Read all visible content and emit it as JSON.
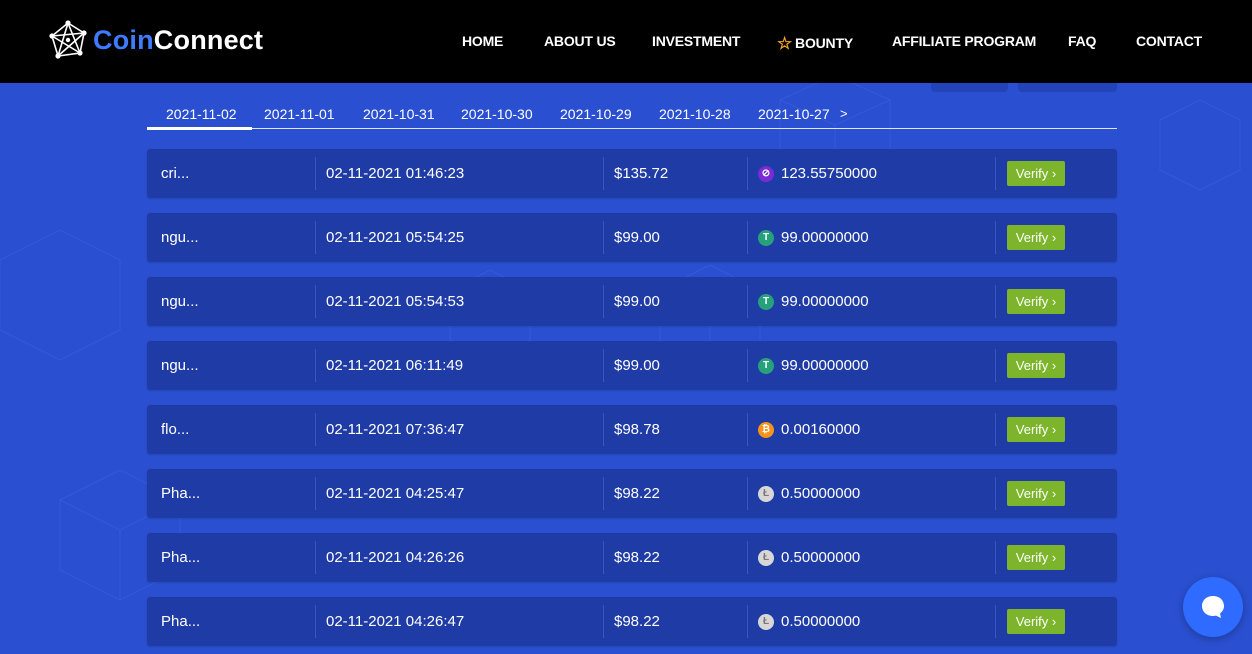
{
  "brand": {
    "part1": "Coin",
    "part2": "Connect"
  },
  "nav": {
    "home": "HOME",
    "about": "ABOUT US",
    "investment": "INVESTMENT",
    "bounty": "BOUNTY",
    "affiliate": "AFFILIATE PROGRAM",
    "faq": "FAQ",
    "contact": "CONTACT"
  },
  "tabs": [
    "2021-11-02",
    "2021-11-01",
    "2021-10-31",
    "2021-10-30",
    "2021-10-29",
    "2021-10-28",
    "2021-10-27"
  ],
  "tab_next": ">",
  "verify_label": "Verify ›",
  "rows": [
    {
      "user": "cri...",
      "time": "02-11-2021 01:46:23",
      "amount": "$135.72",
      "coin": "stellar",
      "coin_amount": "123.55750000"
    },
    {
      "user": "ngu...",
      "time": "02-11-2021 05:54:25",
      "amount": "$99.00",
      "coin": "tether",
      "coin_amount": "99.00000000"
    },
    {
      "user": "ngu...",
      "time": "02-11-2021 05:54:53",
      "amount": "$99.00",
      "coin": "tether",
      "coin_amount": "99.00000000"
    },
    {
      "user": "ngu...",
      "time": "02-11-2021 06:11:49",
      "amount": "$99.00",
      "coin": "tether",
      "coin_amount": "99.00000000"
    },
    {
      "user": "flo...",
      "time": "02-11-2021 07:36:47",
      "amount": "$98.78",
      "coin": "bitcoin",
      "coin_amount": "0.00160000"
    },
    {
      "user": "Pha...",
      "time": "02-11-2021 04:25:47",
      "amount": "$98.22",
      "coin": "litecoin",
      "coin_amount": "0.50000000"
    },
    {
      "user": "Pha...",
      "time": "02-11-2021 04:26:26",
      "amount": "$98.22",
      "coin": "litecoin",
      "coin_amount": "0.50000000"
    },
    {
      "user": "Pha...",
      "time": "02-11-2021 04:26:47",
      "amount": "$98.22",
      "coin": "litecoin",
      "coin_amount": "0.50000000"
    }
  ],
  "colors": {
    "background": "#2a4fd0",
    "row": "#1f3ba6",
    "verify": "#7cb52c",
    "brand_accent": "#3d7bff",
    "chat": "#2f6bff"
  }
}
